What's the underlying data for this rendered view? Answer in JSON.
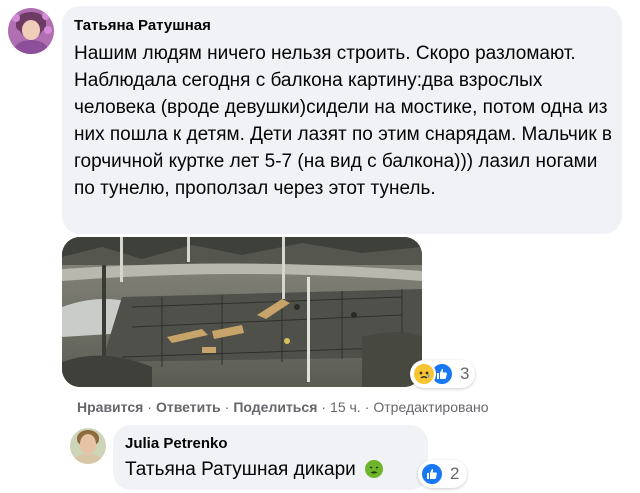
{
  "comment": {
    "author": "Татьяна Ратушная",
    "text": "Нашим людям ничего нельзя строить. Скоро разломают. Наблюдала сегодня с балкона картину:два взрослых человека (вроде девушки)сидели на мостике, потом одна из них пошла к детям. Дети лазят по этим снарядам. Мальчик в горчичной куртке лет 5-7 (на вид с балкона))) лазил ногами по тунелю, проползал через этот тунель.",
    "reactions": {
      "icons": [
        "sad-icon",
        "like-icon"
      ],
      "count": "3"
    },
    "actions": {
      "like": "Нравится",
      "reply": "Ответить",
      "share": "Поделиться",
      "time": "15 ч.",
      "edited": "Отредактировано",
      "separator": "·"
    }
  },
  "reply": {
    "author": "Julia Petrenko",
    "mention": "Татьяна Ратушная",
    "text": "дикари",
    "emoji": "nauseated-face-icon",
    "reactions": {
      "icons": [
        "like-icon"
      ],
      "count": "2"
    }
  },
  "colors": {
    "bubble": "#f0f2f5",
    "meta_text": "#65676b",
    "like_blue": "#1877f2",
    "sad_yellow": "#f7c532"
  }
}
